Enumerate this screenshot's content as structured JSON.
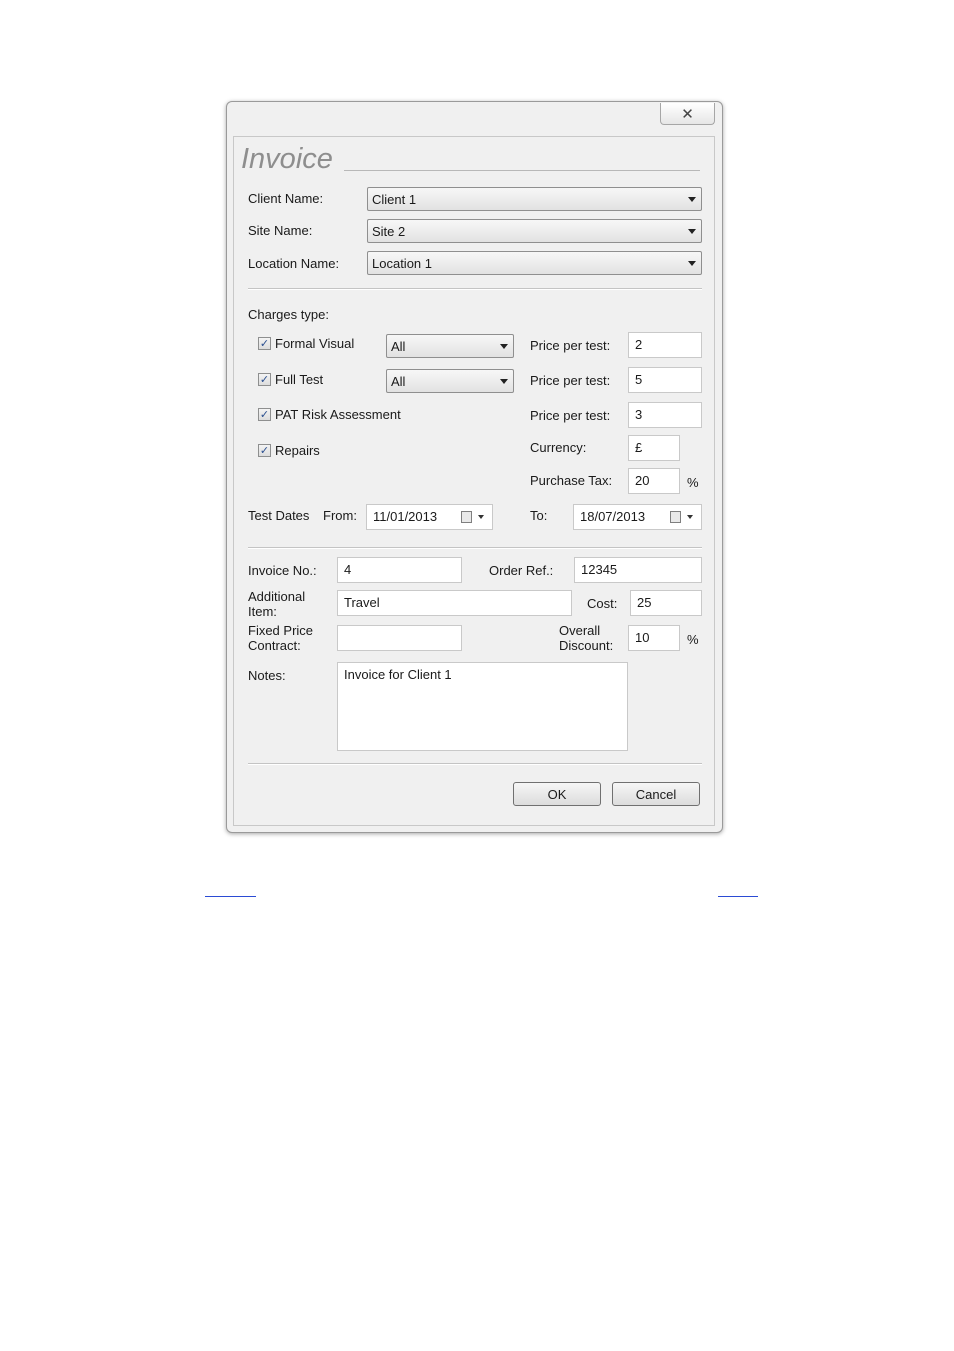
{
  "dialog": {
    "title": "Invoice",
    "close_icon": "close-icon"
  },
  "client": {
    "client_label": "Client Name:",
    "client_value": "Client 1",
    "site_label": "Site Name:",
    "site_value": "Site 2",
    "location_label": "Location Name:",
    "location_value": "Location 1"
  },
  "charges": {
    "heading": "Charges type:",
    "formal_visual": {
      "label": "Formal Visual",
      "checked": true,
      "mode": "All",
      "price_label": "Price per test:",
      "price": "2"
    },
    "full_test": {
      "label": "Full Test",
      "checked": true,
      "mode": "All",
      "price_label": "Price per test:",
      "price": "5"
    },
    "pat_risk": {
      "label": "PAT Risk Assessment",
      "checked": true,
      "price_label": "Price per test:",
      "price": "3"
    },
    "repairs": {
      "label": "Repairs",
      "checked": true
    },
    "currency_label": "Currency:",
    "currency": "£",
    "tax_label": "Purchase Tax:",
    "tax": "20",
    "percent": "%"
  },
  "dates": {
    "label": "Test Dates",
    "from_label": "From:",
    "from": "11/01/2013",
    "to_label": "To:",
    "to": "18/07/2013"
  },
  "invoice": {
    "number_label": "Invoice No.:",
    "number": "4",
    "order_label": "Order Ref.:",
    "order": "12345",
    "additional_label": "Additional\nItem:",
    "additional": "Travel",
    "cost_label": "Cost:",
    "cost": "25",
    "fixed_label": "Fixed Price\nContract:",
    "fixed": "",
    "discount_label": "Overall\nDiscount:",
    "discount": "10",
    "percent": "%",
    "notes_label": "Notes:",
    "notes": "Invoice for Client 1"
  },
  "buttons": {
    "ok": "OK",
    "cancel": "Cancel"
  },
  "checkmark": "✓"
}
